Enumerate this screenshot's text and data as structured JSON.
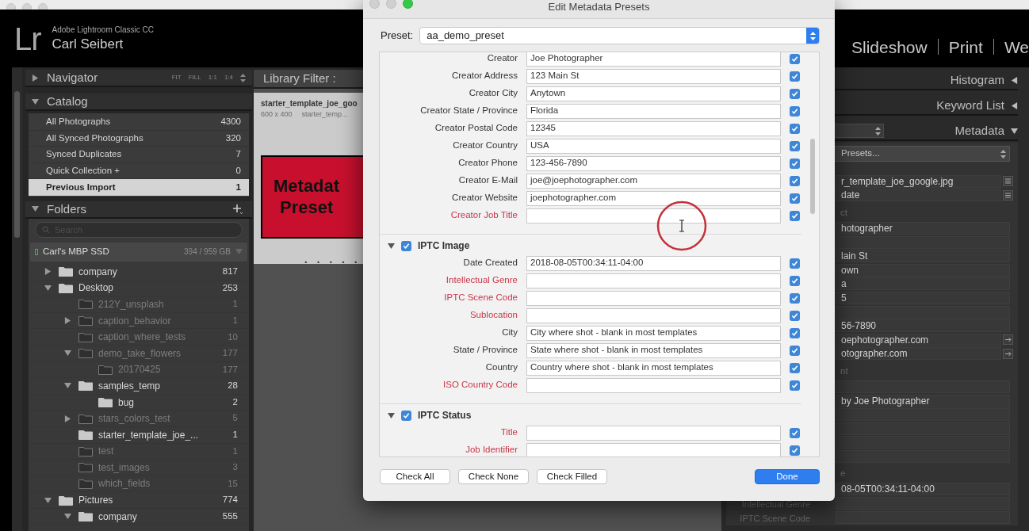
{
  "app": {
    "logo": "Lr",
    "product": "Adobe Lightroom Classic CC",
    "user": "Carl Seibert"
  },
  "modules": [
    {
      "label": "Slideshow"
    },
    {
      "label": "Print"
    },
    {
      "label": "We"
    }
  ],
  "left_panel": {
    "navigator": {
      "title": "Navigator",
      "expanded": false,
      "zoom_options": [
        "FIT",
        "FILL",
        "1:1",
        "1:4"
      ]
    },
    "catalog": {
      "title": "Catalog",
      "expanded": true,
      "items": [
        {
          "name": "All Photographs",
          "count": "4300",
          "selected": false
        },
        {
          "name": "All Synced Photographs",
          "count": "320",
          "selected": false
        },
        {
          "name": "Synced Duplicates",
          "count": "7",
          "selected": false
        },
        {
          "name": "Quick Collection +",
          "count": "0",
          "selected": false
        },
        {
          "name": "Previous Import",
          "count": "1",
          "selected": true
        }
      ]
    },
    "folders": {
      "title": "Folders",
      "expanded": true,
      "search": {
        "placeholder": "Search"
      },
      "volume": {
        "name": "Carl's MBP SSD",
        "usage": "394 / 959 GB"
      },
      "items": [
        {
          "name": "company",
          "count": "817",
          "expanded": false,
          "missing": false
        },
        {
          "name": "Desktop",
          "count": "253",
          "expanded": true,
          "missing": false,
          "children": [
            {
              "name": "212Y_unsplash",
              "count": "1",
              "missing": true
            },
            {
              "name": "caption_behavior",
              "count": "1",
              "expanded": false,
              "missing": true
            },
            {
              "name": "caption_where_tests",
              "count": "10",
              "missing": true
            },
            {
              "name": "demo_take_flowers",
              "count": "177",
              "expanded": true,
              "missing": true,
              "children": [
                {
                  "name": "20170425",
                  "count": "177",
                  "missing": true
                }
              ]
            },
            {
              "name": "samples_temp",
              "count": "28",
              "expanded": true,
              "missing": false,
              "children": [
                {
                  "name": "bug",
                  "count": "2",
                  "missing": false
                }
              ]
            },
            {
              "name": "stars_colors_test",
              "count": "5",
              "expanded": false,
              "missing": true
            },
            {
              "name": "starter_template_joe_...",
              "count": "1",
              "missing": false
            },
            {
              "name": "test",
              "count": "1",
              "missing": true
            },
            {
              "name": "test_images",
              "count": "3",
              "missing": true
            },
            {
              "name": "which_fields",
              "count": "15",
              "missing": true
            }
          ]
        },
        {
          "name": "Pictures",
          "count": "774",
          "expanded": true,
          "missing": false,
          "children": [
            {
              "name": "company",
              "count": "555",
              "expanded": true,
              "missing": false
            }
          ]
        }
      ]
    }
  },
  "library_filter": {
    "label": "Library Filter :"
  },
  "grid": {
    "cells": [
      {
        "filename": "starter_template_joe_goo",
        "dimensions": "600 x 400",
        "caption": "starter_temp...",
        "thumbnail_lines": [
          "Metadat",
          "Preset"
        ]
      }
    ]
  },
  "right_panel": {
    "panels": [
      {
        "title": "Histogram",
        "expanded": false
      },
      {
        "title": "Keyword List",
        "expanded": false
      },
      {
        "title": "Metadata",
        "expanded": true
      }
    ],
    "metadata": {
      "preset": "Presets...",
      "rows": [
        {
          "kind": "value",
          "value": "r_template_joe_google.jpg",
          "button": {
            "kind": "list"
          }
        },
        {
          "kind": "value",
          "value": "date",
          "button": {
            "kind": "list"
          }
        },
        {
          "kind": "heading",
          "text": "ct"
        },
        {
          "kind": "value",
          "value": "hotographer"
        },
        {
          "kind": "value"
        },
        {
          "kind": "value",
          "value": "lain St"
        },
        {
          "kind": "value",
          "value": "own"
        },
        {
          "kind": "value",
          "value": "a"
        },
        {
          "kind": "value",
          "value": "5"
        },
        {
          "kind": "value"
        },
        {
          "kind": "value",
          "value": "56-7890"
        },
        {
          "kind": "value",
          "value": "oephotographer.com",
          "button": {
            "kind": "go"
          }
        },
        {
          "kind": "value",
          "value": "otographer.com",
          "button": {
            "kind": "go"
          }
        },
        {
          "kind": "heading",
          "text": "nt"
        },
        {
          "kind": "value"
        },
        {
          "kind": "value",
          "value": "by Joe Photographer"
        },
        {
          "kind": "value"
        },
        {
          "kind": "value"
        },
        {
          "kind": "value"
        },
        {
          "kind": "value"
        },
        {
          "kind": "heading",
          "text": "e"
        },
        {
          "kind": "value",
          "value": "08-05T00:34:11-04:00"
        },
        {
          "kind": "value",
          "label": "Intellectual Genre"
        },
        {
          "kind": "value",
          "label": "IPTC Scene Code"
        }
      ]
    }
  },
  "dialog": {
    "title": "Edit Metadata Presets",
    "preset_label": "Preset:",
    "preset": "aa_demo_preset",
    "sections": [
      {
        "rows": [
          {
            "label": "Creator",
            "value": "Joe Photographer",
            "checked": true
          },
          {
            "label": "Creator Address",
            "value": "123 Main St",
            "checked": true
          },
          {
            "label": "Creator City",
            "value": "Anytown",
            "checked": true
          },
          {
            "label": "Creator State / Province",
            "value": "Florida",
            "checked": true
          },
          {
            "label": "Creator Postal Code",
            "value": "12345",
            "checked": true
          },
          {
            "label": "Creator Country",
            "value": "USA",
            "checked": true
          },
          {
            "label": "Creator Phone",
            "value": "123-456-7890",
            "checked": true
          },
          {
            "label": "Creator E-Mail",
            "value": "joe@joephotographer.com",
            "checked": true
          },
          {
            "label": "Creator Website",
            "value": "joephotographer.com",
            "checked": true
          },
          {
            "label": "Creator Job Title",
            "checked": true
          }
        ]
      },
      {
        "title": "IPTC Image",
        "checked": true,
        "expanded": true,
        "rows": [
          {
            "label": "Date Created",
            "value": "2018-08-05T00:34:11-04:00",
            "checked": true
          },
          {
            "label": "Intellectual Genre",
            "checked": true
          },
          {
            "label": "IPTC Scene Code",
            "checked": true
          },
          {
            "label": "Sublocation",
            "checked": true
          },
          {
            "label": "City",
            "value": "City where shot - blank in most templates",
            "checked": true
          },
          {
            "label": "State / Province",
            "value": "State where shot - blank in most templates",
            "checked": true
          },
          {
            "label": "Country",
            "value": "Country where shot - blank in most templates",
            "checked": true
          },
          {
            "label": "ISO Country Code",
            "checked": true
          }
        ]
      },
      {
        "title": "IPTC Status",
        "checked": true,
        "expanded": true,
        "rows": [
          {
            "label": "Title",
            "checked": true
          },
          {
            "label": "Job Identifier",
            "checked": true
          }
        ]
      }
    ],
    "buttons": [
      {
        "label": "Check All",
        "kind": "default"
      },
      {
        "label": "Check None",
        "kind": "default"
      },
      {
        "label": "Check Filled",
        "kind": "default"
      },
      {
        "label": "Done",
        "kind": "primary"
      }
    ]
  }
}
